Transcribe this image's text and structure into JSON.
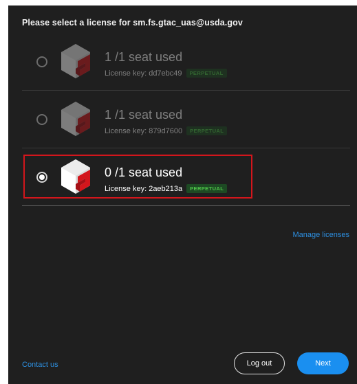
{
  "dialog": {
    "title": "Please select a license for sm.fs.gtac_uas@usda.gov"
  },
  "licenses": [
    {
      "seats": "1 /1 seat used",
      "key_label": "License key: dd7ebc49",
      "badge": "PERPETUAL",
      "selected": false,
      "disabled": true
    },
    {
      "seats": "1 /1 seat used",
      "key_label": "License key: 879d7600",
      "badge": "PERPETUAL",
      "selected": false,
      "disabled": true
    },
    {
      "seats": "0 /1 seat used",
      "key_label": "License key: 2aeb213a",
      "badge": "PERPETUAL",
      "selected": true,
      "disabled": false
    }
  ],
  "links": {
    "manage": "Manage licenses",
    "contact": "Contact us"
  },
  "buttons": {
    "logout": "Log out",
    "next": "Next"
  },
  "icons": {
    "radio": "radio-button-icon",
    "product": "product-logo-icon"
  },
  "colors": {
    "background": "#1f1f1f",
    "accent": "#1a8ff0",
    "selection_outline": "#d3161c",
    "badge_text": "#4fc74a",
    "badge_bg": "#1d4a23",
    "link": "#2d8fe0"
  }
}
